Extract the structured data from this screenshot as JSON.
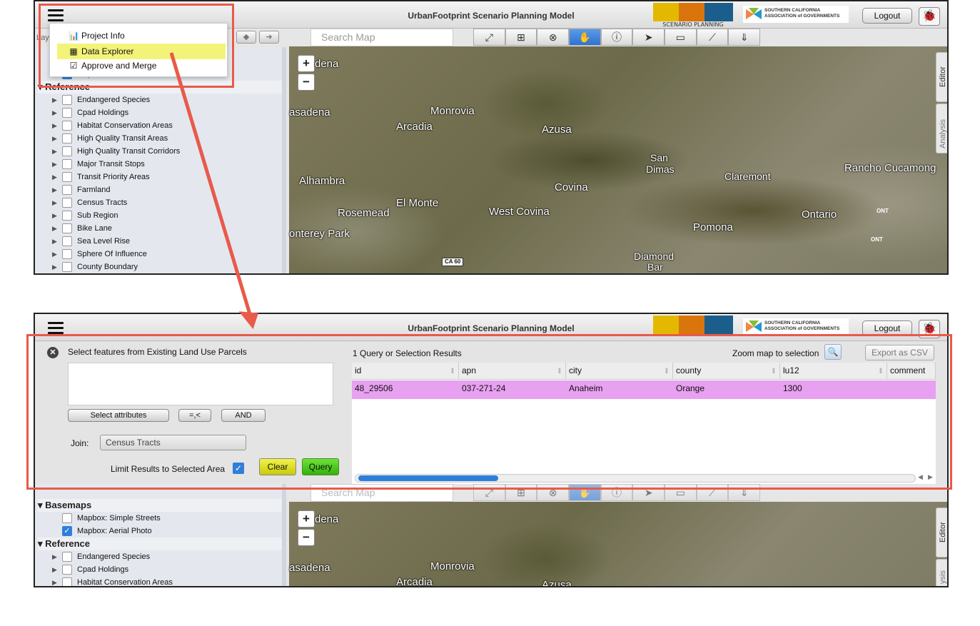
{
  "app": {
    "title": "UrbanFootprint Scenario Planning Model",
    "logo_caption": "SCENARIO PLANNING MODEL",
    "scag_logo_line1": "SOUTHERN CALIFORNIA",
    "scag_logo_line2": "ASSOCIATION of GOVERNMENTS",
    "logout_label": "Logout",
    "bug_icon": "bug-icon"
  },
  "menu": {
    "items": [
      {
        "label": "Project Info",
        "icon": "bar-chart-icon"
      },
      {
        "label": "Data Explorer",
        "icon": "table-icon"
      },
      {
        "label": "Approve and Merge",
        "icon": "checkbox-icon"
      }
    ]
  },
  "sidebar": {
    "layers_label": "Layers",
    "basemaps_label": "Basemaps",
    "reference_label": "Reference",
    "basemaps": [
      {
        "label": "Mapbox: Simple Streets",
        "checked": false
      },
      {
        "label": "Mapbox: Aerial Photo",
        "checked": true
      }
    ],
    "reference": [
      "Endangered Species",
      "Cpad Holdings",
      "Habitat Conservation Areas",
      "High Quality Transit Areas",
      "High Quality Transit Corridors",
      "Major Transit Stops",
      "Transit Priority Areas",
      "Farmland",
      "Census Tracts",
      "Sub Region",
      "Bike Lane",
      "Sea Level Rise",
      "Sphere Of Influence",
      "County Boundary"
    ]
  },
  "map": {
    "search_placeholder": "Search Map",
    "zoom_in": "+",
    "zoom_out": "−",
    "editor_tab": "Editor",
    "analysis_tab": "Analysis",
    "analysis_tab_short": "ysis",
    "cities": [
      "dena",
      "Monrovia",
      "asadena",
      "Arcadia",
      "Azusa",
      "San",
      "Dimas",
      "Claremont",
      "Rancho Cucamong",
      "Alhambra",
      "Covina",
      "El Monte",
      "Rosemead",
      "West Covina",
      "Ontario",
      "onterey Park",
      "Pomona",
      "Diamond",
      "Bar"
    ],
    "labels2": [
      "dena",
      "Monrovia",
      "asadena",
      "Arcadia",
      "Azusa"
    ],
    "shields": [
      "CA 60",
      "ONT",
      "ONT"
    ],
    "tools": [
      "expand-icon",
      "zoom-box-icon",
      "clear-icon",
      "pan-hand-icon",
      "info-icon",
      "pointer-icon",
      "rect-select-icon",
      "polygon-select-icon",
      "export-icon"
    ]
  },
  "explorer": {
    "select_header": "Select features from Existing Land Use Parcels",
    "select_attributes": "Select attributes",
    "operators": "=,<",
    "and_label": "AND",
    "join_label": "Join:",
    "join_value": "Census Tracts",
    "limit_label": "Limit Results to Selected Area",
    "limit_checked": true,
    "clear_label": "Clear",
    "query_label": "Query",
    "results_count": "1 Query or Selection Results",
    "zoom_label": "Zoom map to selection",
    "export_label": "Export as CSV",
    "columns": [
      "id",
      "apn",
      "city",
      "county",
      "lu12",
      "comment"
    ],
    "rows": [
      [
        "48_29506",
        "037-271-24",
        "Anaheim",
        "Orange",
        "1300",
        ""
      ]
    ]
  },
  "colors": {
    "annotation": "#e85a4a",
    "highlight": "#f3f37a",
    "selected_row": "#e8a0f0",
    "active_tool": "#2f73cf",
    "clear_button": "#e0e02a",
    "query_button": "#4cc820"
  }
}
